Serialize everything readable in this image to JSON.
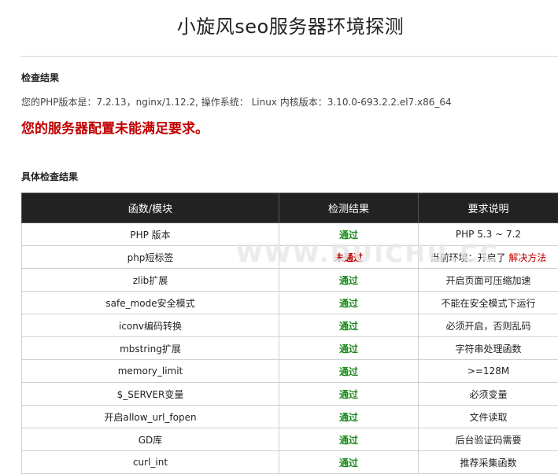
{
  "page": {
    "title": "小旋风seo服务器环境探测"
  },
  "check_result": {
    "heading": "检查结果",
    "info": "您的PHP版本是：7.2.13，nginx/1.12.2, 操作系统： Linux 内核版本：3.10.0-693.2.2.el7.x86_64",
    "warning": "您的服务器配置未能满足要求。"
  },
  "detail": {
    "heading": "具体检查结果",
    "columns": [
      "函数/模块",
      "检测结果",
      "要求说明"
    ],
    "rows": [
      {
        "module": "PHP 版本",
        "status": "通过",
        "status_type": "ok",
        "note": "PHP 5.3 ~ 7.2",
        "fix": ""
      },
      {
        "module": "php短标签",
        "status": "未通过",
        "status_type": "bad",
        "note": "当前环境：开启了",
        "fix": "解决方法"
      },
      {
        "module": "zlib扩展",
        "status": "通过",
        "status_type": "ok",
        "note": "开启页面可压缩加速",
        "fix": ""
      },
      {
        "module": "safe_mode安全模式",
        "status": "通过",
        "status_type": "ok",
        "note": "不能在安全模式下运行",
        "fix": ""
      },
      {
        "module": "iconv编码转换",
        "status": "通过",
        "status_type": "ok",
        "note": "必须开启，否则乱码",
        "fix": ""
      },
      {
        "module": "mbstring扩展",
        "status": "通过",
        "status_type": "ok",
        "note": "字符串处理函数",
        "fix": ""
      },
      {
        "module": "memory_limit",
        "status": "通过",
        "status_type": "ok",
        "note": ">=128M",
        "fix": ""
      },
      {
        "module": "$_SERVER变量",
        "status": "通过",
        "status_type": "ok",
        "note": "必须变量",
        "fix": ""
      },
      {
        "module": "开启allow_url_fopen",
        "status": "通过",
        "status_type": "ok",
        "note": "文件读取",
        "fix": ""
      },
      {
        "module": "GD库",
        "status": "通过",
        "status_type": "ok",
        "note": "后台验证码需要",
        "fix": ""
      },
      {
        "module": "curl_int",
        "status": "通过",
        "status_type": "ok",
        "note": "推荐采集函数",
        "fix": ""
      }
    ]
  },
  "watermark": {
    "text": "WWW.DUICHU.CC"
  },
  "colors": {
    "header_bg": "#222222",
    "ok": "#1a8a1a",
    "bad": "#c00000"
  }
}
